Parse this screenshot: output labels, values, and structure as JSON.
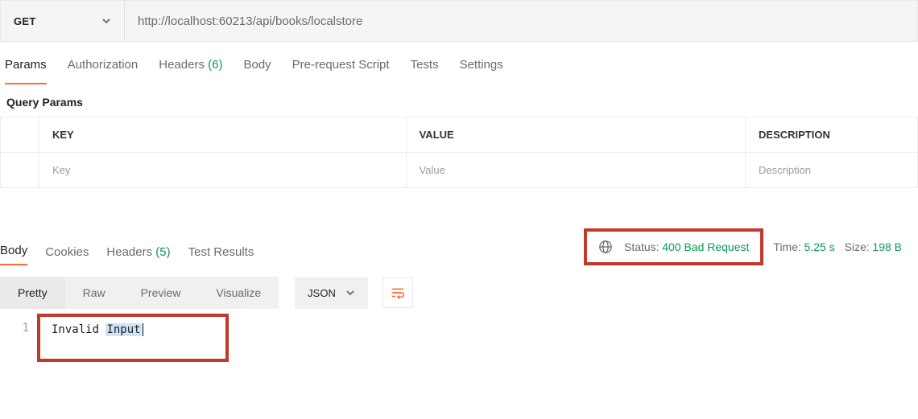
{
  "request": {
    "method": "GET",
    "url": "http://localhost:60213/api/books/localstore"
  },
  "requestTabs": {
    "params": "Params",
    "authorization": "Authorization",
    "headers_label": "Headers",
    "headers_count": "(6)",
    "body": "Body",
    "prerequest": "Pre-request Script",
    "tests": "Tests",
    "settings": "Settings"
  },
  "paramsSection": {
    "title": "Query Params",
    "headers": {
      "key": "KEY",
      "value": "VALUE",
      "description": "DESCRIPTION"
    },
    "placeholder": {
      "key": "Key",
      "value": "Value",
      "description": "Description"
    }
  },
  "responseTabs": {
    "body": "Body",
    "cookies": "Cookies",
    "headers_label": "Headers",
    "headers_count": "(5)",
    "testResults": "Test Results"
  },
  "responseMeta": {
    "statusLabel": "Status:",
    "statusValue": "400 Bad Request",
    "timeLabel": "Time:",
    "timeValue": "5.25 s",
    "sizeLabel": "Size:",
    "sizeValue": "198 B"
  },
  "bodyView": {
    "pretty": "Pretty",
    "raw": "Raw",
    "preview": "Preview",
    "visualize": "Visualize",
    "format": "JSON"
  },
  "responseBody": {
    "lineNumber": "1",
    "word1": "Invalid",
    "word2": "Input"
  }
}
